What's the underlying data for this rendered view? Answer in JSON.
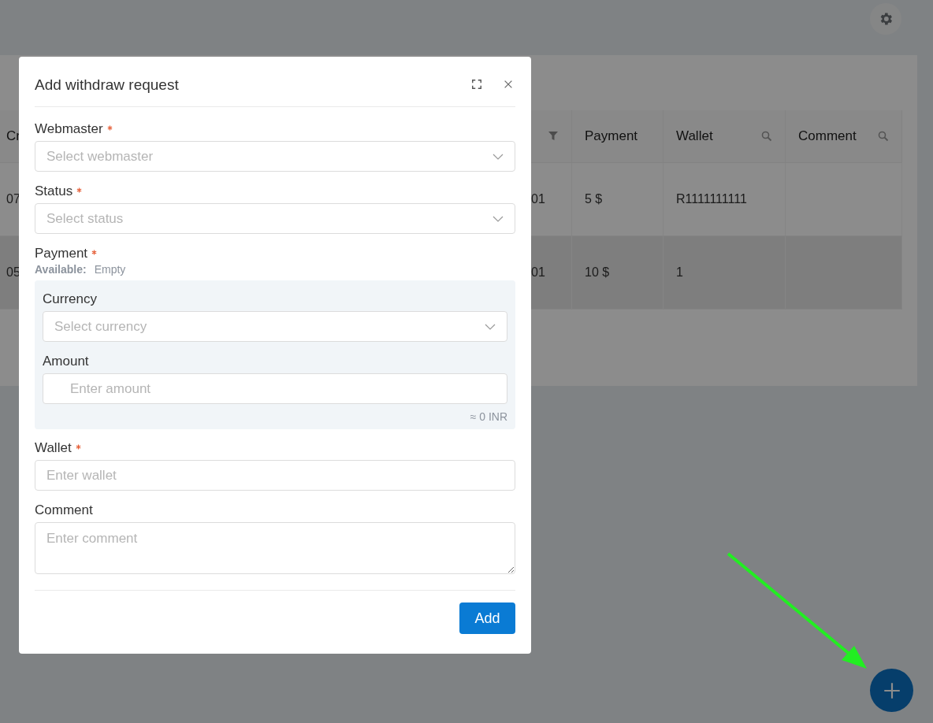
{
  "table": {
    "columns": [
      {
        "kind": "plain",
        "label": "Cr"
      },
      {
        "kind": "filter"
      },
      {
        "kind": "plain",
        "label": "Payment"
      },
      {
        "kind": "search",
        "label": "Wallet"
      },
      {
        "kind": "search",
        "label": "Comment"
      }
    ],
    "rows": [
      {
        "column_1": "07",
        "column_2": "01",
        "payment": "5 $",
        "wallet": "R1111111111",
        "hovered": false
      },
      {
        "column_1": "05",
        "column_2": "01",
        "payment": "10 $",
        "wallet": "1",
        "hovered": true
      }
    ]
  },
  "dialog": {
    "title": "Add withdraw request",
    "fields": [
      {
        "kind": "select",
        "label": "Webmaster",
        "required": true,
        "placeholder": "Select webmaster"
      },
      {
        "kind": "select",
        "label": "Status",
        "required": true,
        "placeholder": "Select status"
      },
      {
        "kind": "group",
        "label": "Payment",
        "required": true,
        "available_label": "Available:",
        "available_value": "Empty",
        "fields": [
          {
            "kind": "select",
            "label": "Currency",
            "required": false,
            "placeholder": "Select currency"
          },
          {
            "kind": "input",
            "label": "Amount",
            "required": false,
            "placeholder": "Enter amount",
            "hint": "≈ 0 INR"
          }
        ]
      },
      {
        "kind": "input",
        "label": "Wallet",
        "required": true,
        "placeholder": "Enter wallet"
      },
      {
        "kind": "textarea",
        "label": "Comment",
        "required": false,
        "placeholder": "Enter comment"
      }
    ],
    "submit": "Add"
  }
}
